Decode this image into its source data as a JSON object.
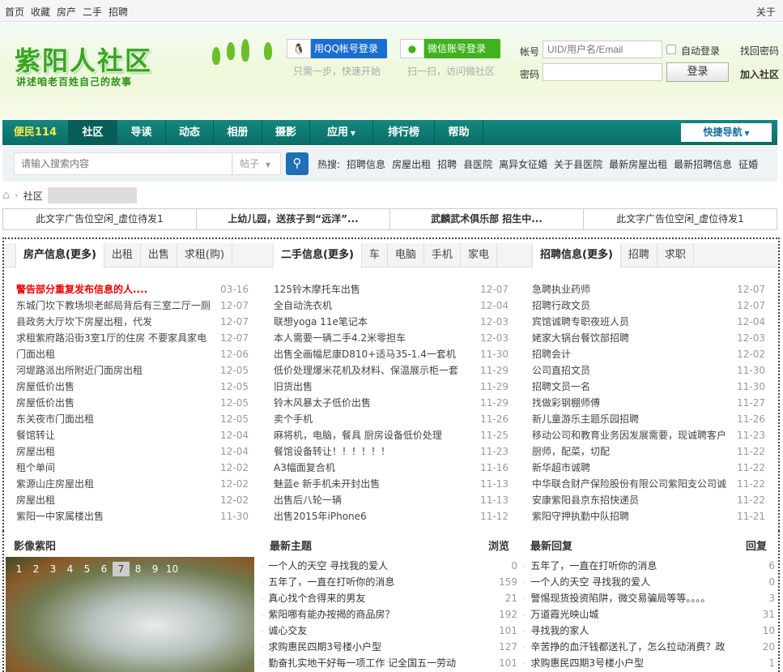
{
  "topbar": {
    "links": [
      "首页",
      "收藏",
      "房产",
      "二手",
      "招聘"
    ],
    "about": "关于"
  },
  "header": {
    "logo": "紫阳人社区",
    "slogan": "讲述咱老百姓自己的故事",
    "qq_login": "用QQ帐号登录",
    "qq_hint": "只需一步，快速开始",
    "wx_login": "微信账号登录",
    "wx_hint": "扫一扫，访问微社区",
    "account_label": "帐号",
    "account_placeholder": "UID/用户名/Email",
    "password_label": "密码",
    "auto_login": "自动登录",
    "login": "登录",
    "find_password": "找回密码",
    "join": "加入社区"
  },
  "nav": {
    "items": [
      "便民114",
      "社区",
      "导读",
      "动态",
      "相册",
      "摄影",
      "应用",
      "排行榜",
      "帮助"
    ],
    "quick": "快捷导航"
  },
  "search": {
    "placeholder": "请输入搜索内容",
    "type": "帖子",
    "hot_label": "热搜:",
    "hot": [
      "招聘信息",
      "房屋出租",
      "招聘",
      "县医院",
      "离异女征婚",
      "关于县医院",
      "最新房屋出租",
      "最新招聘信息",
      "征婚"
    ]
  },
  "breadcrumb": {
    "current": "社区"
  },
  "ads": [
    "此文字广告位空闲_虚位待发1",
    "上幼儿园，送孩子到“远洋”...",
    "武麟武术俱乐部 招生中...",
    "此文字广告位空闲_虚位待发1"
  ],
  "columns": [
    {
      "tabs": [
        "房产信息(更多)",
        "出租",
        "出售",
        "求租(购)"
      ],
      "items": [
        [
          "警告部分重复发布信息的人....",
          "03-16"
        ],
        [
          "东城门坎下教场坝老邮局背后有三室二厅一厕",
          "12-07"
        ],
        [
          "县政务大厅坎下房屋出租，代发",
          "12-07"
        ],
        [
          "求租紫府路沿街3室1厅的住房 不要家具家电",
          "12-07"
        ],
        [
          "门面出租",
          "12-06"
        ],
        [
          "河堤路派出所附近门面房出租",
          "12-05"
        ],
        [
          "房屋低价出售",
          "12-05"
        ],
        [
          "房屋低价出售",
          "12-05"
        ],
        [
          "东关夜市门面出租",
          "12-05"
        ],
        [
          "餐馆转让",
          "12-04"
        ],
        [
          "房屋出租",
          "12-04"
        ],
        [
          "租个单间",
          "12-02"
        ],
        [
          "紫源山庄房屋出租",
          "12-02"
        ],
        [
          "房屋出租",
          "12-02"
        ],
        [
          "紫阳一中家属楼出售",
          "11-30"
        ]
      ]
    },
    {
      "tabs": [
        "二手信息(更多)",
        "车",
        "电脑",
        "手机",
        "家电"
      ],
      "items": [
        [
          "125铃木摩托车出售",
          "12-07"
        ],
        [
          "全自动洗衣机",
          "12-04"
        ],
        [
          "联想yoga 11e笔记本",
          "12-03"
        ],
        [
          "本人需要一辆二手4.2米零担车",
          "12-03"
        ],
        [
          "出售全画幅尼康D810+适马35-1.4一套机",
          "11-30"
        ],
        [
          "低价处理爆米花机及材料、保温展示柜一套",
          "11-29"
        ],
        [
          "旧货出售",
          "11-29"
        ],
        [
          "铃木风暴太子低价出售",
          "11-29"
        ],
        [
          "卖个手机",
          "11-26"
        ],
        [
          "麻将机，电脑，餐具 厨房设备低价处理",
          "11-25"
        ],
        [
          "餐馆设备转让！！！！！！",
          "11-23"
        ],
        [
          "A3幅面复合机",
          "11-16"
        ],
        [
          "魅蓝e 新手机未开封出售",
          "11-13"
        ],
        [
          "出售后八轮一辆",
          "11-13"
        ],
        [
          "出售2015年iPhone6",
          "11-12"
        ]
      ]
    },
    {
      "tabs": [
        "招聘信息(更多)",
        "招聘",
        "求职"
      ],
      "items": [
        [
          "急聘执业药师",
          "12-07"
        ],
        [
          "招聘行政文员",
          "12-07"
        ],
        [
          "宾馆诚聘专职夜班人员",
          "12-04"
        ],
        [
          "姥家大锅台餐饮部招聘",
          "12-03"
        ],
        [
          "招聘会计",
          "12-02"
        ],
        [
          "公司直招文员",
          "11-30"
        ],
        [
          "招聘文员一名",
          "11-30"
        ],
        [
          "找做彩钢棚师傅",
          "11-27"
        ],
        [
          "新儿童游乐主题乐园招聘",
          "11-26"
        ],
        [
          "移动公司和教育业务因发展需要，现诚聘客户",
          "11-23"
        ],
        [
          "厨师，配菜，切配",
          "11-22"
        ],
        [
          "新华超市诚聘",
          "11-22"
        ],
        [
          "中华联合财产保险股份有限公司紫阳支公司诚",
          "11-22"
        ],
        [
          "安康紫阳县京东招快递员",
          "11-22"
        ],
        [
          "紫阳守押执勤中队招聘",
          "11-21"
        ]
      ]
    }
  ],
  "photo": {
    "title": "影像紫阳",
    "pages": [
      "1",
      "2",
      "3",
      "4",
      "5",
      "6",
      "7",
      "8",
      "9",
      "10"
    ],
    "active": "7"
  },
  "latest": {
    "title": "最新主题",
    "col": "浏览",
    "items": [
      [
        "一个人的天空 寻找我的爱人",
        "0"
      ],
      [
        "五年了，一直在打听你的消息",
        "159"
      ],
      [
        "真心找个合得来的男友",
        "21"
      ],
      [
        "紫阳哪有能办按揭的商品房？",
        "192"
      ],
      [
        "诚心交友",
        "101"
      ],
      [
        "求购惠民四期3号楼小户型",
        "127"
      ],
      [
        "勤奋扎实地干好每一项工作 记全国五一劳动",
        "101"
      ]
    ]
  },
  "replies": {
    "title": "最新回复",
    "col": "回复",
    "items": [
      [
        "五年了，一直在打听你的消息",
        "6"
      ],
      [
        "一个人的天空 寻找我的爱人",
        "0"
      ],
      [
        "警惕现货投资陷阱，微交易骗局等等。。。。",
        "3"
      ],
      [
        "万道霞光映山城",
        "31"
      ],
      [
        "寻找我的家人",
        "10"
      ],
      [
        "辛苦挣的血汗钱都送礼了，怎么拉动消费？政",
        "20"
      ],
      [
        "求购惠民四期3号楼小户型",
        "1"
      ]
    ]
  }
}
